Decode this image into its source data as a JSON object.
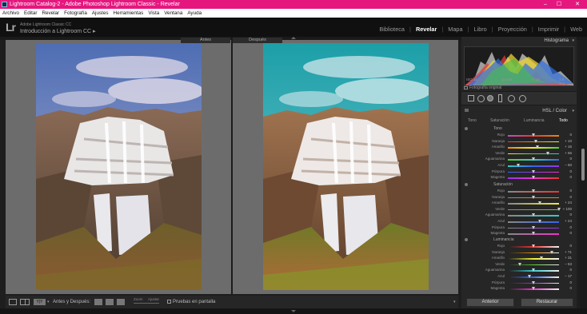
{
  "titlebar": {
    "title": "Lightroom Catalog-2 - Adobe Photoshop Lightroom Classic - Revelar",
    "min": "–",
    "max": "☐",
    "close": "✕"
  },
  "menu": [
    "Archivo",
    "Editar",
    "Revelar",
    "Fotografía",
    "Ajustes",
    "Herramientas",
    "Vista",
    "Ventana",
    "Ayuda"
  ],
  "identity": {
    "logo": "Lr",
    "line1": "Adobe Lightroom Classic CC",
    "line2": "Introducción a Lightroom CC",
    "arrow": "▸"
  },
  "modules": [
    "Biblioteca",
    "Revelar",
    "Mapa",
    "Libro",
    "Proyección",
    "Imprimir",
    "Web"
  ],
  "active_module": "Revelar",
  "view": {
    "before_label": "Antes",
    "after_label": "Después"
  },
  "filmbar": {
    "view_label": "Antes y Después:",
    "zoom_label": "Zoom",
    "adjust_label": "Ajustar",
    "proof_label": "Pruebas en pantalla"
  },
  "histogram": {
    "title": "Histograma",
    "exif": {
      "iso": "ISO 50",
      "focal": "11 mm",
      "aperture": "f / 16",
      "shutter": "2.5 seg"
    },
    "original_label": "Fotografía original"
  },
  "hsl": {
    "title": "HSL / Color",
    "tabs": [
      "Tono",
      "Saturación",
      "Luminancia",
      "Todo"
    ],
    "active_tab": "Todo",
    "colors": [
      "Rojo",
      "Naranja",
      "Amarillo",
      "Verde",
      "Aguamarina",
      "Azul",
      "Púrpura",
      "Magenta"
    ],
    "sections": [
      {
        "title": "Tono",
        "values": [
          "0",
          "+ 10",
          "+ 16",
          "+ 56",
          "0",
          "– 60",
          "0",
          "0"
        ]
      },
      {
        "title": "Saturación",
        "values": [
          "0",
          "0",
          "+ 24",
          "+ 100",
          "0",
          "+ 24",
          "0",
          "0"
        ]
      },
      {
        "title": "Luminancia",
        "values": [
          "0",
          "+ 71",
          "+ 31",
          "– 53",
          "0",
          "– 17",
          "0",
          "0"
        ]
      }
    ]
  },
  "buttons": {
    "previous": "Anterior",
    "reset": "Restaurar"
  }
}
